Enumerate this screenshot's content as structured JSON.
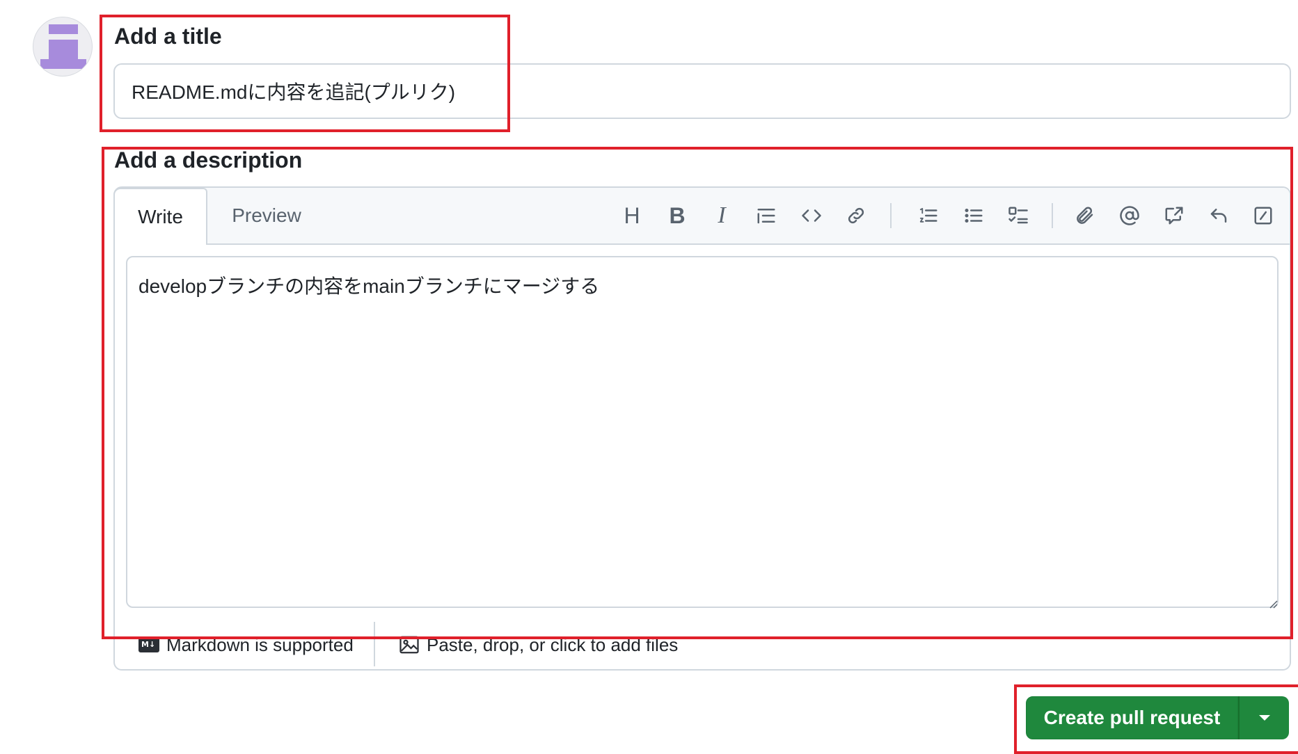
{
  "title_section": {
    "heading": "Add a title",
    "value": "README.mdに内容を追記(プルリク)"
  },
  "description_section": {
    "heading": "Add a description",
    "tabs": [
      {
        "label": "Write",
        "active": true
      },
      {
        "label": "Preview",
        "active": false
      }
    ],
    "toolbar": [
      {
        "name": "heading",
        "icon": "heading-icon"
      },
      {
        "name": "bold",
        "icon": "bold-icon"
      },
      {
        "name": "italic",
        "icon": "italic-icon"
      },
      {
        "name": "quote",
        "icon": "quote-icon"
      },
      {
        "name": "code",
        "icon": "code-icon"
      },
      {
        "name": "link",
        "icon": "link-icon"
      },
      {
        "name": "numbered-list",
        "icon": "numbered-list-icon"
      },
      {
        "name": "unordered-list",
        "icon": "unordered-list-icon"
      },
      {
        "name": "task-list",
        "icon": "task-list-icon"
      },
      {
        "name": "attach",
        "icon": "paperclip-icon"
      },
      {
        "name": "mention",
        "icon": "mention-icon"
      },
      {
        "name": "cross-reference",
        "icon": "cross-reference-icon"
      },
      {
        "name": "saved-replies",
        "icon": "reply-icon"
      },
      {
        "name": "slash-commands",
        "icon": "slash-command-icon"
      }
    ],
    "body": "developブランチの内容をmainブランチにマージする",
    "footer": {
      "markdown_label": "Markdown is supported",
      "markdown_icon_text": "M↓",
      "files_label": "Paste, drop, or click to add files"
    }
  },
  "actions": {
    "create_label": "Create pull request"
  },
  "colors": {
    "annotation": "#e0202b",
    "primary_button": "#1f883d",
    "border": "#d0d7de",
    "toolbar_header": "#f6f8fa"
  }
}
